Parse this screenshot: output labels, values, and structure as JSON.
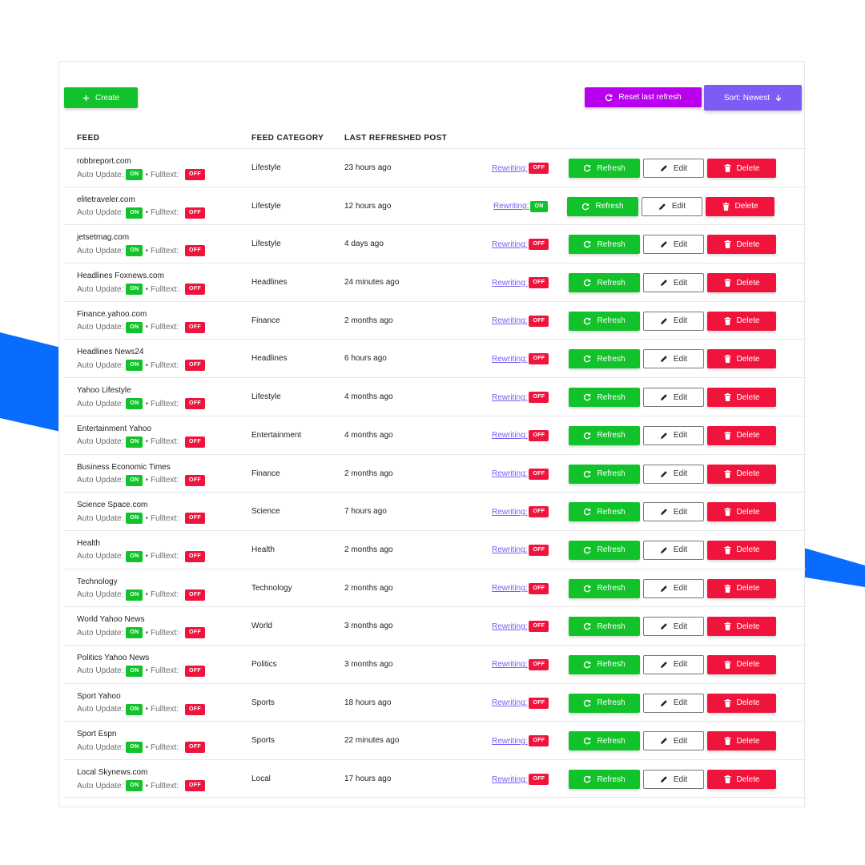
{
  "toolbar": {
    "create_label": "Create",
    "reset_label": "Reset last refresh",
    "sort_label": "Sort: Newest"
  },
  "table": {
    "headers": [
      "FEED",
      "FEED CATEGORY",
      "LAST REFRESHED POST"
    ],
    "auto_update_label": "Auto Update:",
    "fulltext_label": "Fulltext:",
    "separator": "•",
    "rewriting_label": "Rewriting:",
    "refresh_label": "Refresh",
    "edit_label": "Edit",
    "delete_label": "Delete",
    "rows": [
      {
        "name": "robbreport.com",
        "auto_update": "ON",
        "fulltext": "OFF",
        "category": "Lifestyle",
        "last": "23 hours ago",
        "rewriting": "OFF"
      },
      {
        "name": "elitetraveler.com",
        "auto_update": "ON",
        "fulltext": "OFF",
        "category": "Lifestyle",
        "last": "12 hours ago",
        "rewriting": "ON"
      },
      {
        "name": "jetsetmag.com",
        "auto_update": "ON",
        "fulltext": "OFF",
        "category": "Lifestyle",
        "last": "4 days ago",
        "rewriting": "OFF"
      },
      {
        "name": "Headlines Foxnews.com",
        "auto_update": "ON",
        "fulltext": "OFF",
        "category": "Headlines",
        "last": "24 minutes ago",
        "rewriting": "OFF"
      },
      {
        "name": "Finance.yahoo.com",
        "auto_update": "ON",
        "fulltext": "OFF",
        "category": "Finance",
        "last": "2 months ago",
        "rewriting": "OFF"
      },
      {
        "name": "Headlines News24",
        "auto_update": "ON",
        "fulltext": "OFF",
        "category": "Headlines",
        "last": "6 hours ago",
        "rewriting": "OFF"
      },
      {
        "name": "Yahoo Lifestyle",
        "auto_update": "ON",
        "fulltext": "OFF",
        "category": "Lifestyle",
        "last": "4 months ago",
        "rewriting": "OFF"
      },
      {
        "name": "Entertainment Yahoo",
        "auto_update": "ON",
        "fulltext": "OFF",
        "category": "Entertainment",
        "last": "4 months ago",
        "rewriting": "OFF"
      },
      {
        "name": "Business Economic Times",
        "auto_update": "ON",
        "fulltext": "OFF",
        "category": "Finance",
        "last": "2 months ago",
        "rewriting": "OFF"
      },
      {
        "name": "Science Space.com",
        "auto_update": "ON",
        "fulltext": "OFF",
        "category": "Science",
        "last": "7 hours ago",
        "rewriting": "OFF"
      },
      {
        "name": "Health",
        "auto_update": "ON",
        "fulltext": "OFF",
        "category": "Health",
        "last": "2 months ago",
        "rewriting": "OFF"
      },
      {
        "name": "Technology",
        "auto_update": "ON",
        "fulltext": "OFF",
        "category": "Technology",
        "last": "2 months ago",
        "rewriting": "OFF"
      },
      {
        "name": "World Yahoo News",
        "auto_update": "ON",
        "fulltext": "OFF",
        "category": "World",
        "last": "3 months ago",
        "rewriting": "OFF"
      },
      {
        "name": "Politics Yahoo News",
        "auto_update": "ON",
        "fulltext": "OFF",
        "category": "Politics",
        "last": "3 months ago",
        "rewriting": "OFF"
      },
      {
        "name": "Sport Yahoo",
        "auto_update": "ON",
        "fulltext": "OFF",
        "category": "Sports",
        "last": "18 hours ago",
        "rewriting": "OFF"
      },
      {
        "name": "Sport Espn",
        "auto_update": "ON",
        "fulltext": "OFF",
        "category": "Sports",
        "last": "22 minutes ago",
        "rewriting": "OFF"
      },
      {
        "name": "Local Skynews.com",
        "auto_update": "ON",
        "fulltext": "OFF",
        "category": "Local",
        "last": "17 hours ago",
        "rewriting": "OFF"
      }
    ]
  },
  "colors": {
    "green": "#12c22a",
    "red": "#f0143c",
    "magenta": "#b800ef",
    "purple": "#7c5cf5",
    "blue_decor": "#0a6cff"
  },
  "icons": [
    "plus-icon",
    "refresh-icon",
    "arrow-down-icon",
    "pencil-icon",
    "trash-icon"
  ]
}
